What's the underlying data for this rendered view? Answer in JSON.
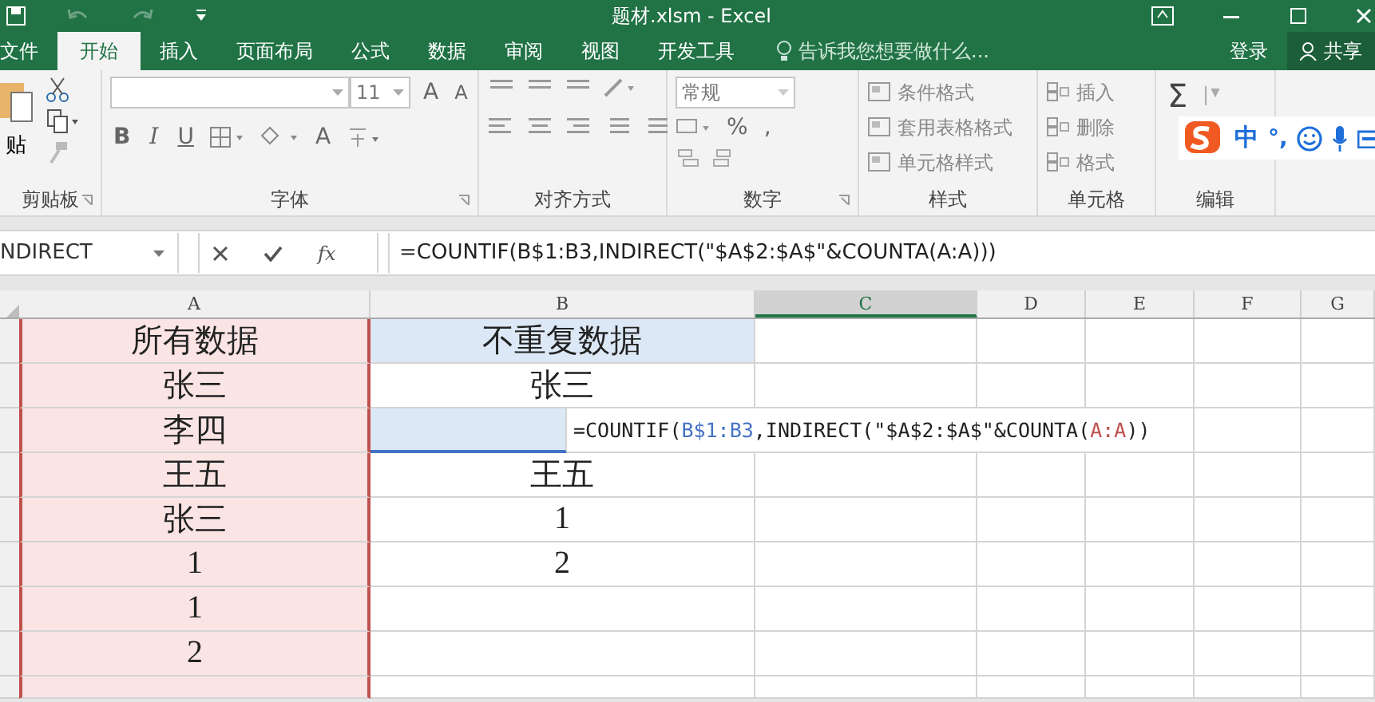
{
  "window": {
    "title": "题材.xlsm - Excel"
  },
  "tabs": [
    {
      "label": "文件",
      "selected": false
    },
    {
      "label": "开始",
      "selected": true
    },
    {
      "label": "插入",
      "selected": false
    },
    {
      "label": "页面布局",
      "selected": false
    },
    {
      "label": "公式",
      "selected": false
    },
    {
      "label": "数据",
      "selected": false
    },
    {
      "label": "审阅",
      "selected": false
    },
    {
      "label": "视图",
      "selected": false
    },
    {
      "label": "开发工具",
      "selected": false
    }
  ],
  "tell_me": {
    "placeholder": "告诉我您想要做什么..."
  },
  "account": {
    "login": "登录",
    "share": "共享"
  },
  "ribbon": {
    "clipboard": {
      "label": "剪贴板",
      "paste": "贴"
    },
    "font": {
      "label": "字体",
      "size": "11",
      "grow": "A",
      "shrink": "A",
      "bold": "B",
      "italic": "I",
      "underline": "U",
      "font_color": "A"
    },
    "alignment": {
      "label": "对齐方式"
    },
    "number": {
      "label": "数字",
      "format": "常规",
      "percent": "%",
      "comma": ","
    },
    "styles": {
      "label": "样式",
      "items": [
        "条件格式",
        "套用表格格式",
        "单元格样式"
      ]
    },
    "cells": {
      "label": "单元格",
      "items": [
        "插入",
        "删除",
        "格式"
      ]
    },
    "editing": {
      "label": "编辑",
      "sum": "Σ"
    }
  },
  "ime": {
    "mode": "中",
    "punct": "°,"
  },
  "formula_bar": {
    "name_box": "NDIRECT",
    "fx": "fx",
    "formula": "=COUNTIF(B$1:B3,INDIRECT(\"$A$2:$A$\"&COUNTA(A:A)))"
  },
  "columns": [
    {
      "label": "A",
      "selected": false,
      "color": "#c0504d"
    },
    {
      "label": "B",
      "selected": false
    },
    {
      "label": "C",
      "selected": true
    },
    {
      "label": "D",
      "selected": false
    },
    {
      "label": "E",
      "selected": false
    },
    {
      "label": "F",
      "selected": false
    },
    {
      "label": "G",
      "selected": false
    }
  ],
  "rows": [
    {
      "cells": [
        {
          "text": "所有数据",
          "color": "#fbe4e4"
        },
        {
          "text": "不重复数据",
          "color": "#dde8f6"
        }
      ]
    },
    {
      "cells": [
        {
          "text": "张三",
          "color": "#fbe4e4"
        },
        {
          "text": "张三"
        }
      ]
    },
    {
      "cells": [
        {
          "text": "李四",
          "color": "#fbe4e4"
        },
        {
          "color": "#dde8f6",
          "editing": [
            {
              "text": "=COUNTIF("
            },
            {
              "text": "B$1:B3",
              "color": "#4472c4"
            },
            {
              "text": ",INDIRECT(\"$A$2:$A$\"&COUNTA("
            },
            {
              "text": "A:A",
              "color": "#c0504d"
            },
            {
              "text": "))"
            }
          ]
        }
      ]
    },
    {
      "cells": [
        {
          "text": "王五",
          "color": "#fbe4e4"
        },
        {
          "text": "王五"
        }
      ]
    },
    {
      "cells": [
        {
          "text": "张三",
          "color": "#fbe4e4"
        },
        {
          "text": "1"
        }
      ]
    },
    {
      "cells": [
        {
          "text": "1",
          "color": "#fbe4e4"
        },
        {
          "text": "2"
        }
      ]
    },
    {
      "cells": [
        {
          "text": "1",
          "color": "#fbe4e4"
        },
        {}
      ]
    },
    {
      "cells": [
        {
          "text": "2",
          "color": "#fbe4e4"
        },
        {}
      ]
    },
    {
      "cells": [
        {
          "color": "#fbe4e4"
        },
        {}
      ]
    }
  ]
}
